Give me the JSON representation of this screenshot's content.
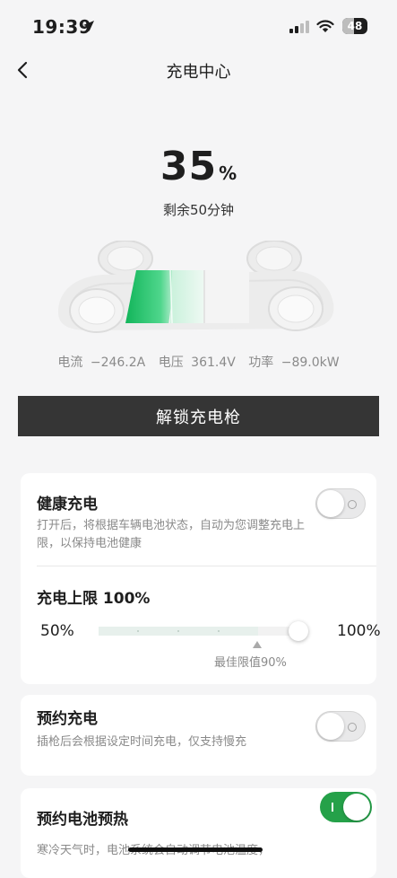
{
  "status_bar": {
    "time": "19:39",
    "battery_level": "48",
    "battery_fraction": 0.48,
    "icons": [
      "location-arrow-icon",
      "cellular-signal-icon",
      "wifi-icon",
      "battery-icon"
    ]
  },
  "header": {
    "title": "充电中心",
    "back_icon": "chevron-left-icon"
  },
  "charge": {
    "percent": "35",
    "unit": "%",
    "level": 0.35,
    "remaining": "剩余50分钟"
  },
  "metrics": {
    "current_label": "电流",
    "current_value": "−246.2A",
    "voltage_label": "电压",
    "voltage_value": "361.4V",
    "power_label": "功率",
    "power_value": "−89.0kW"
  },
  "unlock_button": {
    "label": "解锁充电枪"
  },
  "health_charging": {
    "title": "健康充电",
    "description": "打开后，将根据车辆电池状态，自动为您调整充电上限，以保持电池健康",
    "enabled": false
  },
  "charge_limit": {
    "title": "充电上限 100%",
    "min_label": "50%",
    "max_label": "100%",
    "value_percent": 100,
    "best_label": "最佳限值90%",
    "best_value_percent": 90
  },
  "scheduled_charging": {
    "title": "预约充电",
    "description": "插枪后会根据设定时间充电，仅支持慢充",
    "enabled": false
  },
  "battery_preheat": {
    "title": "预约电池预热",
    "description": "寒冷天气时，电池系统会自动调节电池温度，",
    "enabled": true
  },
  "colors": {
    "accent_green": "#25a149",
    "charge_green": "#1fbf6a",
    "button_dark": "#353535"
  }
}
